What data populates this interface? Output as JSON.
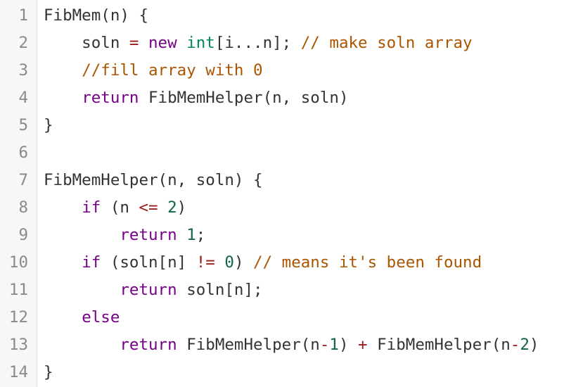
{
  "lines": [
    {
      "number": "1",
      "tokens": [
        {
          "t": "FibMem(n) {",
          "c": "fn"
        }
      ]
    },
    {
      "number": "2",
      "tokens": [
        {
          "t": "    soln ",
          "c": "fn"
        },
        {
          "t": "=",
          "c": "op"
        },
        {
          "t": " ",
          "c": "fn"
        },
        {
          "t": "new",
          "c": "kw"
        },
        {
          "t": " ",
          "c": "fn"
        },
        {
          "t": "int",
          "c": "ty"
        },
        {
          "t": "[i...n]; ",
          "c": "fn"
        },
        {
          "t": "// make soln array",
          "c": "cm"
        }
      ]
    },
    {
      "number": "3",
      "tokens": [
        {
          "t": "    ",
          "c": "fn"
        },
        {
          "t": "//fill array with 0",
          "c": "cm"
        }
      ]
    },
    {
      "number": "4",
      "tokens": [
        {
          "t": "    ",
          "c": "fn"
        },
        {
          "t": "return",
          "c": "kw"
        },
        {
          "t": " FibMemHelper(n, soln)",
          "c": "fn"
        }
      ]
    },
    {
      "number": "5",
      "tokens": [
        {
          "t": "}",
          "c": "fn"
        }
      ]
    },
    {
      "number": "6",
      "tokens": []
    },
    {
      "number": "7",
      "tokens": [
        {
          "t": "FibMemHelper(n, soln) {",
          "c": "fn"
        }
      ]
    },
    {
      "number": "8",
      "tokens": [
        {
          "t": "    ",
          "c": "fn"
        },
        {
          "t": "if",
          "c": "kw"
        },
        {
          "t": " (n ",
          "c": "fn"
        },
        {
          "t": "<=",
          "c": "op"
        },
        {
          "t": " ",
          "c": "fn"
        },
        {
          "t": "2",
          "c": "num"
        },
        {
          "t": ")",
          "c": "fn"
        }
      ]
    },
    {
      "number": "9",
      "tokens": [
        {
          "t": "        ",
          "c": "fn"
        },
        {
          "t": "return",
          "c": "kw"
        },
        {
          "t": " ",
          "c": "fn"
        },
        {
          "t": "1",
          "c": "num"
        },
        {
          "t": ";",
          "c": "fn"
        }
      ]
    },
    {
      "number": "10",
      "tokens": [
        {
          "t": "    ",
          "c": "fn"
        },
        {
          "t": "if",
          "c": "kw"
        },
        {
          "t": " (soln[n] ",
          "c": "fn"
        },
        {
          "t": "!=",
          "c": "op"
        },
        {
          "t": " ",
          "c": "fn"
        },
        {
          "t": "0",
          "c": "num"
        },
        {
          "t": ") ",
          "c": "fn"
        },
        {
          "t": "// means it's been found",
          "c": "cm"
        }
      ]
    },
    {
      "number": "11",
      "tokens": [
        {
          "t": "        ",
          "c": "fn"
        },
        {
          "t": "return",
          "c": "kw"
        },
        {
          "t": " soln[n];",
          "c": "fn"
        }
      ]
    },
    {
      "number": "12",
      "tokens": [
        {
          "t": "    ",
          "c": "fn"
        },
        {
          "t": "else",
          "c": "kw"
        }
      ]
    },
    {
      "number": "13",
      "tokens": [
        {
          "t": "        ",
          "c": "fn"
        },
        {
          "t": "return",
          "c": "kw"
        },
        {
          "t": " FibMemHelper(n",
          "c": "fn"
        },
        {
          "t": "-",
          "c": "op"
        },
        {
          "t": "1",
          "c": "num"
        },
        {
          "t": ") ",
          "c": "fn"
        },
        {
          "t": "+",
          "c": "op"
        },
        {
          "t": " FibMemHelper(n",
          "c": "fn"
        },
        {
          "t": "-",
          "c": "op"
        },
        {
          "t": "2",
          "c": "num"
        },
        {
          "t": ")",
          "c": "fn"
        }
      ]
    },
    {
      "number": "14",
      "tokens": [
        {
          "t": "}",
          "c": "fn"
        }
      ]
    }
  ],
  "colors": {
    "keyword": "#770088",
    "type": "#008855",
    "number": "#116644",
    "operator": "#981a1a",
    "comment": "#aa5500",
    "text": "#333333",
    "line_number": "#8a8a8a",
    "gutter_bg": "#f7f7f7"
  }
}
